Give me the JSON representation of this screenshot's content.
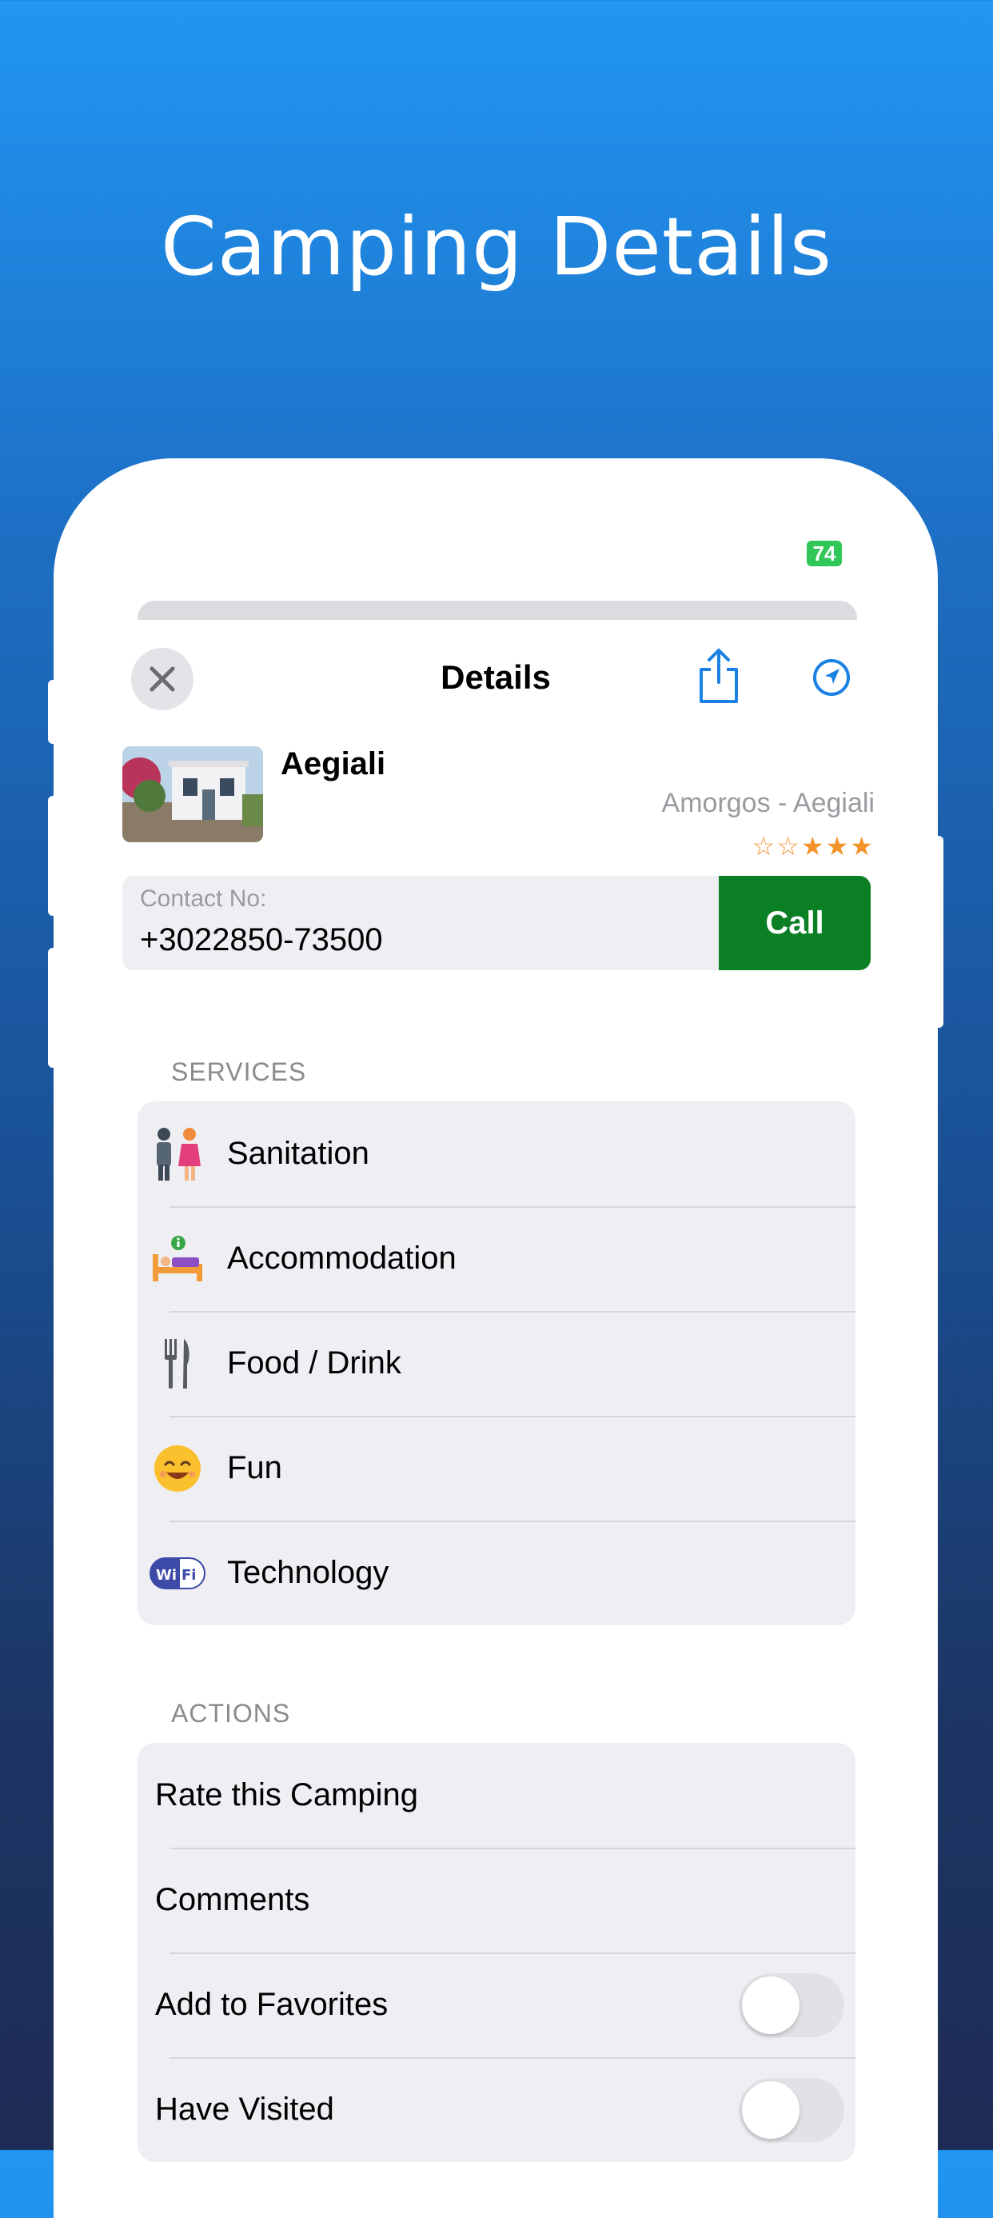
{
  "headline": "Camping Details",
  "status": {
    "battery": "74"
  },
  "nav": {
    "title": "Details",
    "close_icon": "close-icon",
    "share_icon": "share-icon",
    "navigate_icon": "location-arrow-icon"
  },
  "camping": {
    "name": "Aegiali",
    "location": "Amorgos - Aegiali",
    "stars_text": "☆☆★★★",
    "rating": 3,
    "rating_max": 5
  },
  "contact": {
    "label": "Contact No:",
    "value": "+3022850-73500",
    "call_label": "Call"
  },
  "services": {
    "header": "SERVICES",
    "items": [
      {
        "label": "Sanitation",
        "icon": "restroom-icon"
      },
      {
        "label": "Accommodation",
        "icon": "bed-icon"
      },
      {
        "label": "Food / Drink",
        "icon": "fork-knife-icon"
      },
      {
        "label": "Fun",
        "icon": "smiley-icon"
      },
      {
        "label": "Technology",
        "icon": "wifi-icon"
      }
    ]
  },
  "actions": {
    "header": "ACTIONS",
    "items": [
      {
        "label": "Rate this Camping"
      },
      {
        "label": "Comments"
      },
      {
        "label": "Add to Favorites",
        "toggle": false
      },
      {
        "label": "Have Visited",
        "toggle": false
      }
    ]
  },
  "colors": {
    "accent": "#1a82e2",
    "call_button": "#0b7f24",
    "star": "#f2932c",
    "battery": "#30c759"
  }
}
